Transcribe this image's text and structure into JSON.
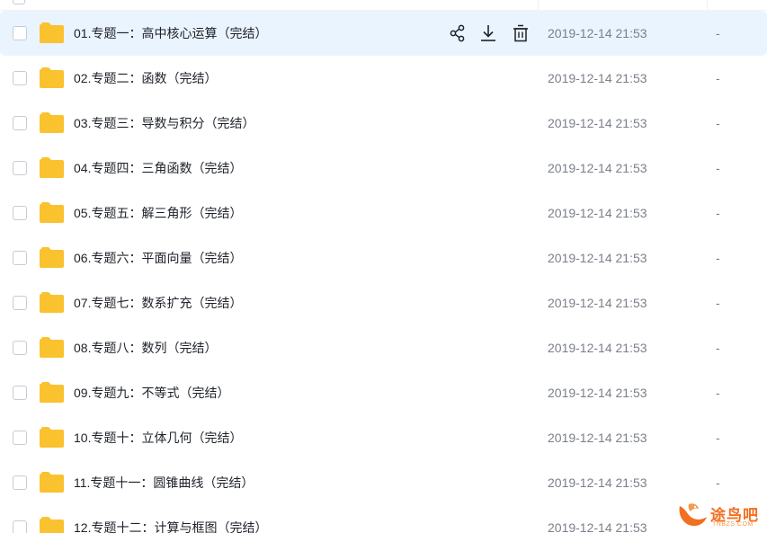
{
  "files": [
    {
      "name": "01.专题一：高中核心运算（完结）",
      "modified": "2019-12-14 21:53",
      "size": "-",
      "hovered": true
    },
    {
      "name": "02.专题二：函数（完结）",
      "modified": "2019-12-14 21:53",
      "size": "-"
    },
    {
      "name": "03.专题三：导数与积分（完结）",
      "modified": "2019-12-14 21:53",
      "size": "-"
    },
    {
      "name": "04.专题四：三角函数（完结）",
      "modified": "2019-12-14 21:53",
      "size": "-"
    },
    {
      "name": "05.专题五：解三角形（完结）",
      "modified": "2019-12-14 21:53",
      "size": "-"
    },
    {
      "name": "06.专题六：平面向量（完结）",
      "modified": "2019-12-14 21:53",
      "size": "-"
    },
    {
      "name": "07.专题七：数系扩充（完结）",
      "modified": "2019-12-14 21:53",
      "size": "-"
    },
    {
      "name": "08.专题八：数列（完结）",
      "modified": "2019-12-14 21:53",
      "size": "-"
    },
    {
      "name": "09.专题九：不等式（完结）",
      "modified": "2019-12-14 21:53",
      "size": "-"
    },
    {
      "name": "10.专题十：立体几何（完结）",
      "modified": "2019-12-14 21:53",
      "size": "-"
    },
    {
      "name": "11.专题十一：圆锥曲线（完结）",
      "modified": "2019-12-14 21:53",
      "size": "-"
    },
    {
      "name": "12.专题十二：计算与框图（完结）",
      "modified": "2019-12-14 21:53",
      "size": ""
    }
  ],
  "row_actions": {
    "share_icon": "share-icon",
    "download_icon": "download-icon",
    "delete_icon": "trash-icon"
  },
  "watermark": {
    "text": "途鸟吧",
    "subtext": "TNBZS.COM"
  },
  "colors": {
    "folder": "#f9c22e",
    "hover_row": "#eaf4fe",
    "accent": "#f26f21"
  }
}
